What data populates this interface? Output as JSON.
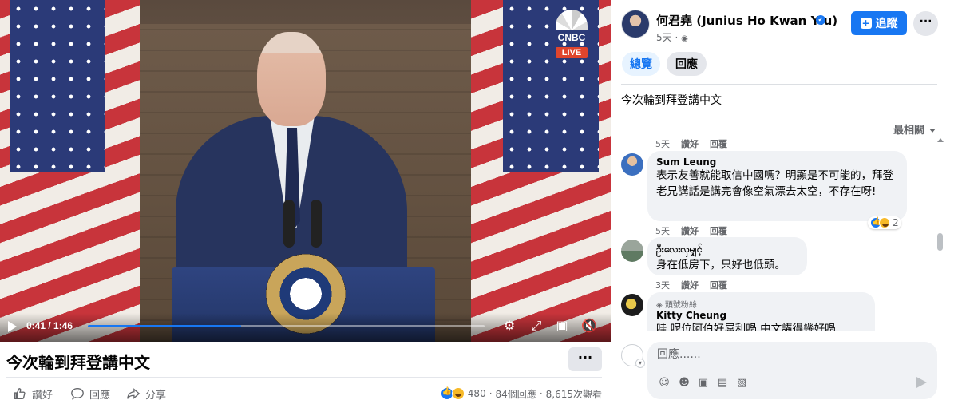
{
  "video": {
    "channel_logo_text": "CNBC",
    "live_badge": "LIVE",
    "current_time": "0:41",
    "duration": "1:46",
    "time_display": "0:41 / 1:46",
    "progress_fraction": 0.387
  },
  "post": {
    "title": "今次輪到拜登講中文",
    "more_label": "···",
    "actions": {
      "like": "讚好",
      "comment": "回應",
      "share": "分享"
    },
    "stats": {
      "reactions": "480",
      "comments": "84個回應",
      "views": "8,615次觀看",
      "separator": "·"
    }
  },
  "author": {
    "name": "何君堯 (Junius Ho Kwan Yiu)",
    "time": "5天 · ",
    "follow_label": "追蹤",
    "more_label": "···"
  },
  "tabs": [
    {
      "label": "總覽"
    },
    {
      "label": "回應"
    }
  ],
  "caption": "今次輪到拜登講中文",
  "sort_label": "最相關",
  "comments": [
    {
      "name": "Sum Leung",
      "text": "表示友善就能取信中國嗎？明顯是不可能的，拜登老兄講話是講完會像空氣漂去太空，不存在呀!",
      "meta_above": {
        "time": "5天",
        "like": "讚好",
        "reply": "回覆"
      },
      "meta": {
        "time": "5天",
        "like": "讚好",
        "reply": "回覆"
      },
      "reaction_count": "2"
    },
    {
      "name": "ဦးလေးလှမျှင့်",
      "text": "身在低房下，只好也低頭。",
      "meta": {
        "time": "3天",
        "like": "讚好",
        "reply": "回覆"
      }
    },
    {
      "badge": "頭號粉絲",
      "name": "Kitty Cheung",
      "text": "哇 呢位阿伯好屌利喎 中文講得幾好喎"
    }
  ],
  "composer": {
    "placeholder": "回應......"
  },
  "colors": {
    "accent": "#1877f2",
    "bubble": "#f0f2f5",
    "muted": "#65676b",
    "live": "#e0452d"
  }
}
